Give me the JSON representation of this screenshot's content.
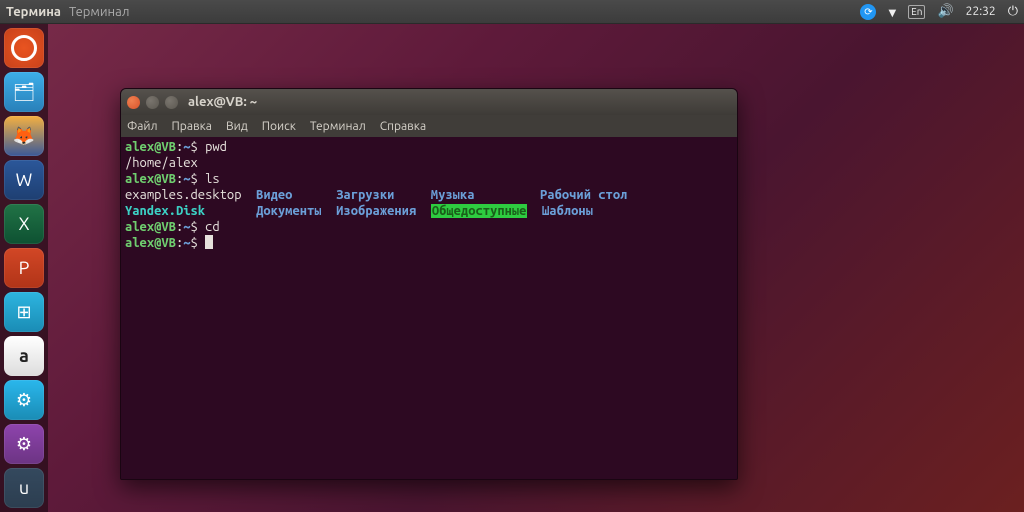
{
  "panel": {
    "app_active": "Термина",
    "app_label": "Терминал",
    "network_icon": "▼",
    "lang": "En",
    "volume_icon": "🔊",
    "time": "22:32",
    "power_icon": "⏻"
  },
  "launcher": [
    {
      "id": "ubuntu-dash",
      "glyph": ""
    },
    {
      "id": "files",
      "glyph": "🗂"
    },
    {
      "id": "firefox",
      "glyph": "🦊"
    },
    {
      "id": "word",
      "glyph": "W"
    },
    {
      "id": "excel",
      "glyph": "X"
    },
    {
      "id": "ppt",
      "glyph": "P"
    },
    {
      "id": "software",
      "glyph": "⊞"
    },
    {
      "id": "amazon",
      "glyph": "a"
    },
    {
      "id": "settings",
      "glyph": "⚙"
    },
    {
      "id": "settings2",
      "glyph": "⚙"
    },
    {
      "id": "usb",
      "glyph": "u"
    }
  ],
  "window": {
    "title": "alex@VB: ~",
    "menu": {
      "file": "Файл",
      "edit": "Правка",
      "view": "Вид",
      "search": "Поиск",
      "terminal": "Терминал",
      "help": "Справка"
    }
  },
  "prompt": {
    "user": "alex",
    "at": "@",
    "host": "VB",
    "colon": ":",
    "path": "~",
    "symbol": "$"
  },
  "session": {
    "cmd1": "pwd",
    "out1": "/home/alex",
    "cmd2": "ls",
    "ls_cols": [
      [
        "examples.desktop",
        "plain"
      ],
      [
        "Yandex.Disk",
        "link"
      ],
      [
        "Видео",
        "dir"
      ],
      [
        "Документы",
        "dir"
      ],
      [
        "Загрузки",
        "dir"
      ],
      [
        "Изображения",
        "dir"
      ],
      [
        "Музыка",
        "dir"
      ],
      [
        "Общедоступные",
        "hl"
      ],
      [
        "Рабочий стол",
        "dir"
      ],
      [
        "Шаблоны",
        "dir"
      ]
    ],
    "ls_row1": "examples.desktop  Видео      Загрузки     Музыка        Рабочий стол",
    "ls_row2": "Yandex.Disk       Документы  Изображения  Общедоступные Шаблоны",
    "cmd3": "cd",
    "cmd4": ""
  }
}
